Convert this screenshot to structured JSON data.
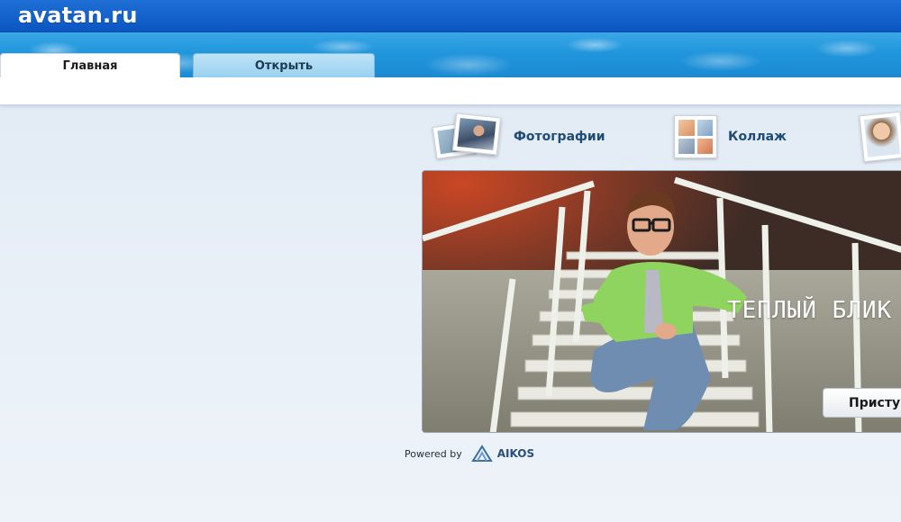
{
  "site": {
    "logo": "avatan.ru"
  },
  "tabs": [
    {
      "label": "Главная",
      "active": true
    },
    {
      "label": "Открыть",
      "active": false
    }
  ],
  "features": [
    {
      "label": "Фотографии",
      "icon": "photos-icon"
    },
    {
      "label": "Коллаж",
      "icon": "collage-icon"
    },
    {
      "label": "",
      "icon": "face-photo-icon"
    }
  ],
  "banner": {
    "caption": "ТЕПЛЫЙ БЛИК",
    "button_label": "Присту"
  },
  "footer": {
    "powered_by": "Powered by",
    "brand": "AIKOS"
  },
  "colors": {
    "topbar": "#0a56c2",
    "tab_active": "#ffffff",
    "tab_inactive": "#99d1f0",
    "feature_text": "#1e4c74",
    "brand_text": "#2b4f78"
  }
}
